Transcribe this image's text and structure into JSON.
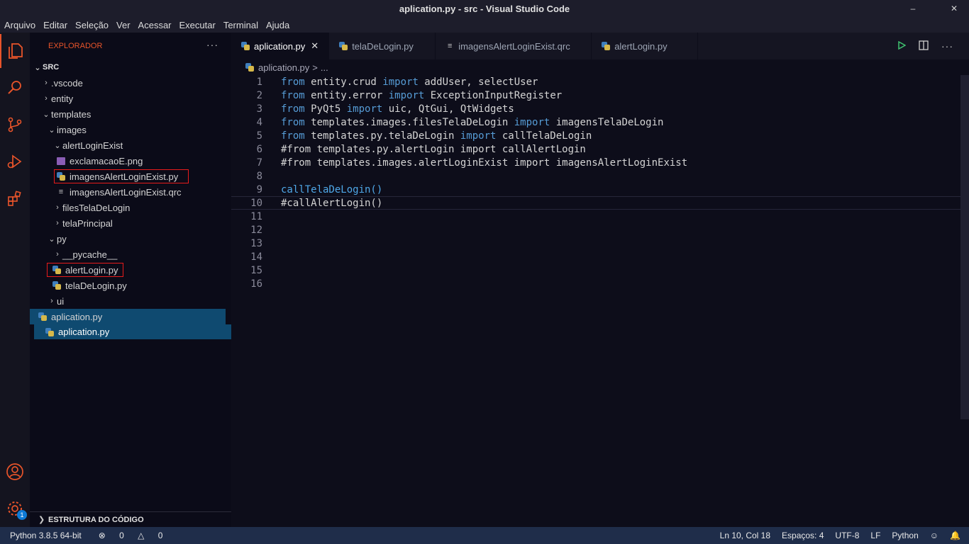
{
  "window": {
    "title": "aplication.py - src - Visual Studio Code",
    "minimize": "–",
    "close": "✕"
  },
  "menu": [
    "Arquivo",
    "Editar",
    "Seleção",
    "Ver",
    "Acessar",
    "Executar",
    "Terminal",
    "Ajuda"
  ],
  "activity": {
    "settings_badge": "1"
  },
  "sidebar": {
    "header": "EXPLORADOR",
    "more": "···",
    "root": "SRC",
    "tree": [
      {
        "label": ".vscode",
        "type": "folder",
        "open": false,
        "depth": 0
      },
      {
        "label": "entity",
        "type": "folder",
        "open": false,
        "depth": 0
      },
      {
        "label": "templates",
        "type": "folder",
        "open": true,
        "depth": 0
      },
      {
        "label": "images",
        "type": "folder",
        "open": true,
        "depth": 1
      },
      {
        "label": "alertLoginExist",
        "type": "folder",
        "open": true,
        "depth": 2
      },
      {
        "label": "exclamacaoE.png",
        "type": "image",
        "depth": 3
      },
      {
        "label": "imagensAlertLoginExist.py",
        "type": "py",
        "depth": 3,
        "highlighted": true
      },
      {
        "label": "imagensAlertLoginExist.qrc",
        "type": "txt",
        "depth": 3
      },
      {
        "label": "filesTelaDeLogin",
        "type": "folder",
        "open": false,
        "depth": 2
      },
      {
        "label": "telaPrincipal",
        "type": "folder",
        "open": false,
        "depth": 2
      },
      {
        "label": "py",
        "type": "folder",
        "open": true,
        "depth": 1
      },
      {
        "label": "__pycache__",
        "type": "folder",
        "open": false,
        "depth": 2
      },
      {
        "label": "alertLogin.py",
        "type": "py",
        "depth": 2,
        "highlighted": true
      },
      {
        "label": "telaDeLogin.py",
        "type": "py",
        "depth": 2
      },
      {
        "label": "ui",
        "type": "folder",
        "open": false,
        "depth": 1
      },
      {
        "label": "aplication.py",
        "type": "py",
        "depth": 0,
        "selected": true
      }
    ],
    "drag_label": "aplication.py",
    "outline": "ESTRUTURA DO CÓDIGO"
  },
  "tabs": [
    {
      "label": "aplication.py",
      "icon": "py",
      "active": true,
      "close": "✕"
    },
    {
      "label": "telaDeLogin.py",
      "icon": "py",
      "active": false
    },
    {
      "label": "imagensAlertLoginExist.qrc",
      "icon": "txt",
      "active": false
    },
    {
      "label": "alertLogin.py",
      "icon": "py",
      "active": false
    }
  ],
  "breadcrumb": {
    "file": "aplication.py",
    "sep": ">",
    "rest": "..."
  },
  "code": [
    {
      "n": "1",
      "parts": [
        [
          "kw",
          "from"
        ],
        [
          "t",
          " entity.crud "
        ],
        [
          "kw",
          "import"
        ],
        [
          "t",
          " addUser, selectUser"
        ]
      ]
    },
    {
      "n": "2",
      "parts": [
        [
          "kw",
          "from"
        ],
        [
          "t",
          " entity.error "
        ],
        [
          "kw",
          "import"
        ],
        [
          "t",
          " ExceptionInputRegister"
        ]
      ]
    },
    {
      "n": "3",
      "parts": [
        [
          "kw",
          "from"
        ],
        [
          "t",
          " PyQt5 "
        ],
        [
          "kw",
          "import"
        ],
        [
          "t",
          " uic, QtGui, QtWidgets"
        ]
      ]
    },
    {
      "n": "4",
      "parts": [
        [
          "kw",
          "from"
        ],
        [
          "t",
          " templates.images.filesTelaDeLogin "
        ],
        [
          "kw",
          "import"
        ],
        [
          "t",
          " imagensTelaDeLogin"
        ]
      ]
    },
    {
      "n": "5",
      "parts": [
        [
          "kw",
          "from"
        ],
        [
          "t",
          " templates.py.telaDeLogin "
        ],
        [
          "kw",
          "import"
        ],
        [
          "t",
          " callTelaDeLogin"
        ]
      ]
    },
    {
      "n": "6",
      "parts": [
        [
          "t",
          "#from templates.py.alertLogin import callAlertLogin"
        ]
      ]
    },
    {
      "n": "7",
      "parts": [
        [
          "t",
          "#from templates.images.alertLoginExist import imagensAlertLoginExist"
        ]
      ]
    },
    {
      "n": "8",
      "parts": []
    },
    {
      "n": "9",
      "parts": [
        [
          "fn",
          "callTelaDeLogin()"
        ]
      ]
    },
    {
      "n": "10",
      "parts": [
        [
          "t",
          "#callAlertLogin()"
        ]
      ],
      "current": true
    },
    {
      "n": "11",
      "parts": []
    },
    {
      "n": "12",
      "parts": []
    },
    {
      "n": "13",
      "parts": []
    },
    {
      "n": "14",
      "parts": []
    },
    {
      "n": "15",
      "parts": []
    },
    {
      "n": "16",
      "parts": []
    }
  ],
  "status": {
    "interpreter": "Python 3.8.5 64-bit",
    "errors": "0",
    "warnings": "0",
    "position": "Ln 10, Col 18",
    "indent": "Espaços: 4",
    "encoding": "UTF-8",
    "eol": "LF",
    "language": "Python"
  }
}
